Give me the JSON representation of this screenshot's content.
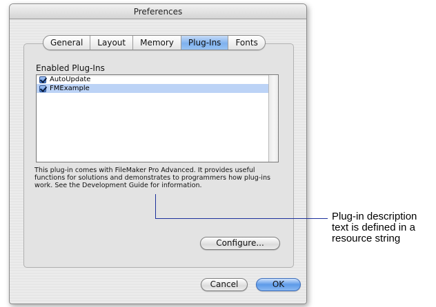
{
  "window": {
    "title": "Preferences"
  },
  "tabs": [
    {
      "label": "General",
      "active": false
    },
    {
      "label": "Layout",
      "active": false
    },
    {
      "label": "Memory",
      "active": false
    },
    {
      "label": "Plug-Ins",
      "active": true
    },
    {
      "label": "Fonts",
      "active": false
    }
  ],
  "plugins": {
    "section_label": "Enabled Plug-Ins",
    "items": [
      {
        "label": "AutoUpdate",
        "checked": true,
        "selected": false
      },
      {
        "label": "FMExample",
        "checked": true,
        "selected": true
      }
    ],
    "description": "This plug-in comes with FileMaker Pro Advanced. It provides useful functions for solutions and demonstrates to programmers how plug-ins work. See the Development Guide for information."
  },
  "buttons": {
    "configure": "Configure...",
    "cancel": "Cancel",
    "ok": "OK"
  },
  "callout": {
    "text": "Plug-in description text is defined in a resource string"
  },
  "colors": {
    "selection": "#bcd3f6",
    "callout_line": "#1b2f9b",
    "default_button": "#5d9ae9"
  }
}
